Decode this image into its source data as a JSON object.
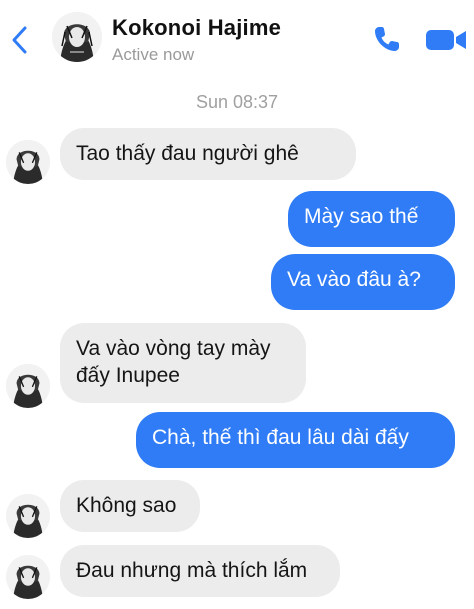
{
  "header": {
    "contact_name": "Kokonoi Hajime",
    "status": "Active now",
    "back_icon": "chevron-left-icon",
    "call_icon": "phone-icon",
    "video_icon": "video-camera-icon",
    "accent_color": "#2f7cf6"
  },
  "conversation": {
    "timestamp": "Sun 08:37",
    "messages": [
      {
        "direction": "incoming",
        "text": "Tao thấy đau người ghê"
      },
      {
        "direction": "outgoing",
        "text": "Mày sao thế"
      },
      {
        "direction": "outgoing",
        "text": "Va vào đâu à?"
      },
      {
        "direction": "incoming",
        "text": "Va vào vòng tay mày\nđấy Inupee"
      },
      {
        "direction": "outgoing",
        "text": "Chà, thế thì đau lâu dài đấy"
      },
      {
        "direction": "incoming",
        "text": "Không sao"
      },
      {
        "direction": "incoming",
        "text": "Đau nhưng mà thích lắm"
      }
    ]
  },
  "colors": {
    "incoming_bubble": "#ececec",
    "outgoing_bubble": "#2f7cf6"
  }
}
